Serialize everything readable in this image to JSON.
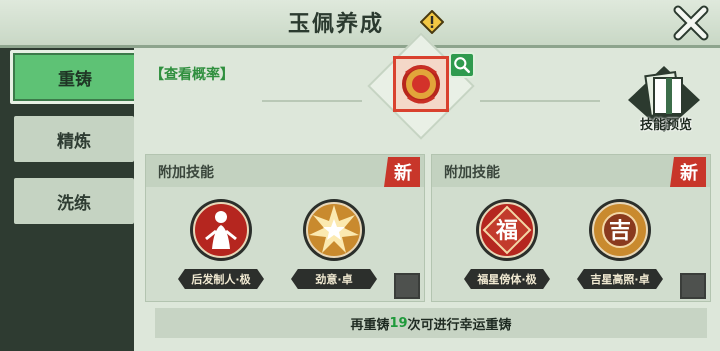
{
  "header": {
    "title": "玉佩养成"
  },
  "side_tabs": [
    {
      "label": "重铸",
      "active": true
    },
    {
      "label": "精炼",
      "active": false
    },
    {
      "label": "洗练",
      "active": false
    }
  ],
  "probability_link": "【查看概率】",
  "skill_preview_label": "技能预览",
  "cards": [
    {
      "title": "附加技能",
      "new_badge": "新",
      "skills": [
        {
          "label": "后发制人·极",
          "icon": "figure-icon"
        },
        {
          "label": "劲意·卓",
          "icon": "burst-icon"
        }
      ]
    },
    {
      "title": "附加技能",
      "new_badge": "新",
      "skills": [
        {
          "label": "福星傍体·极",
          "icon": "fu-character-icon",
          "glyph": "福"
        },
        {
          "label": "吉星高照·卓",
          "icon": "ji-character-icon",
          "glyph": "吉"
        }
      ]
    }
  ],
  "bottom": {
    "prefix": "再重铸",
    "count": "19",
    "suffix": "次可进行幸运重铸"
  },
  "colors": {
    "accent_green": "#5ec275",
    "new_red": "#c8362a"
  }
}
